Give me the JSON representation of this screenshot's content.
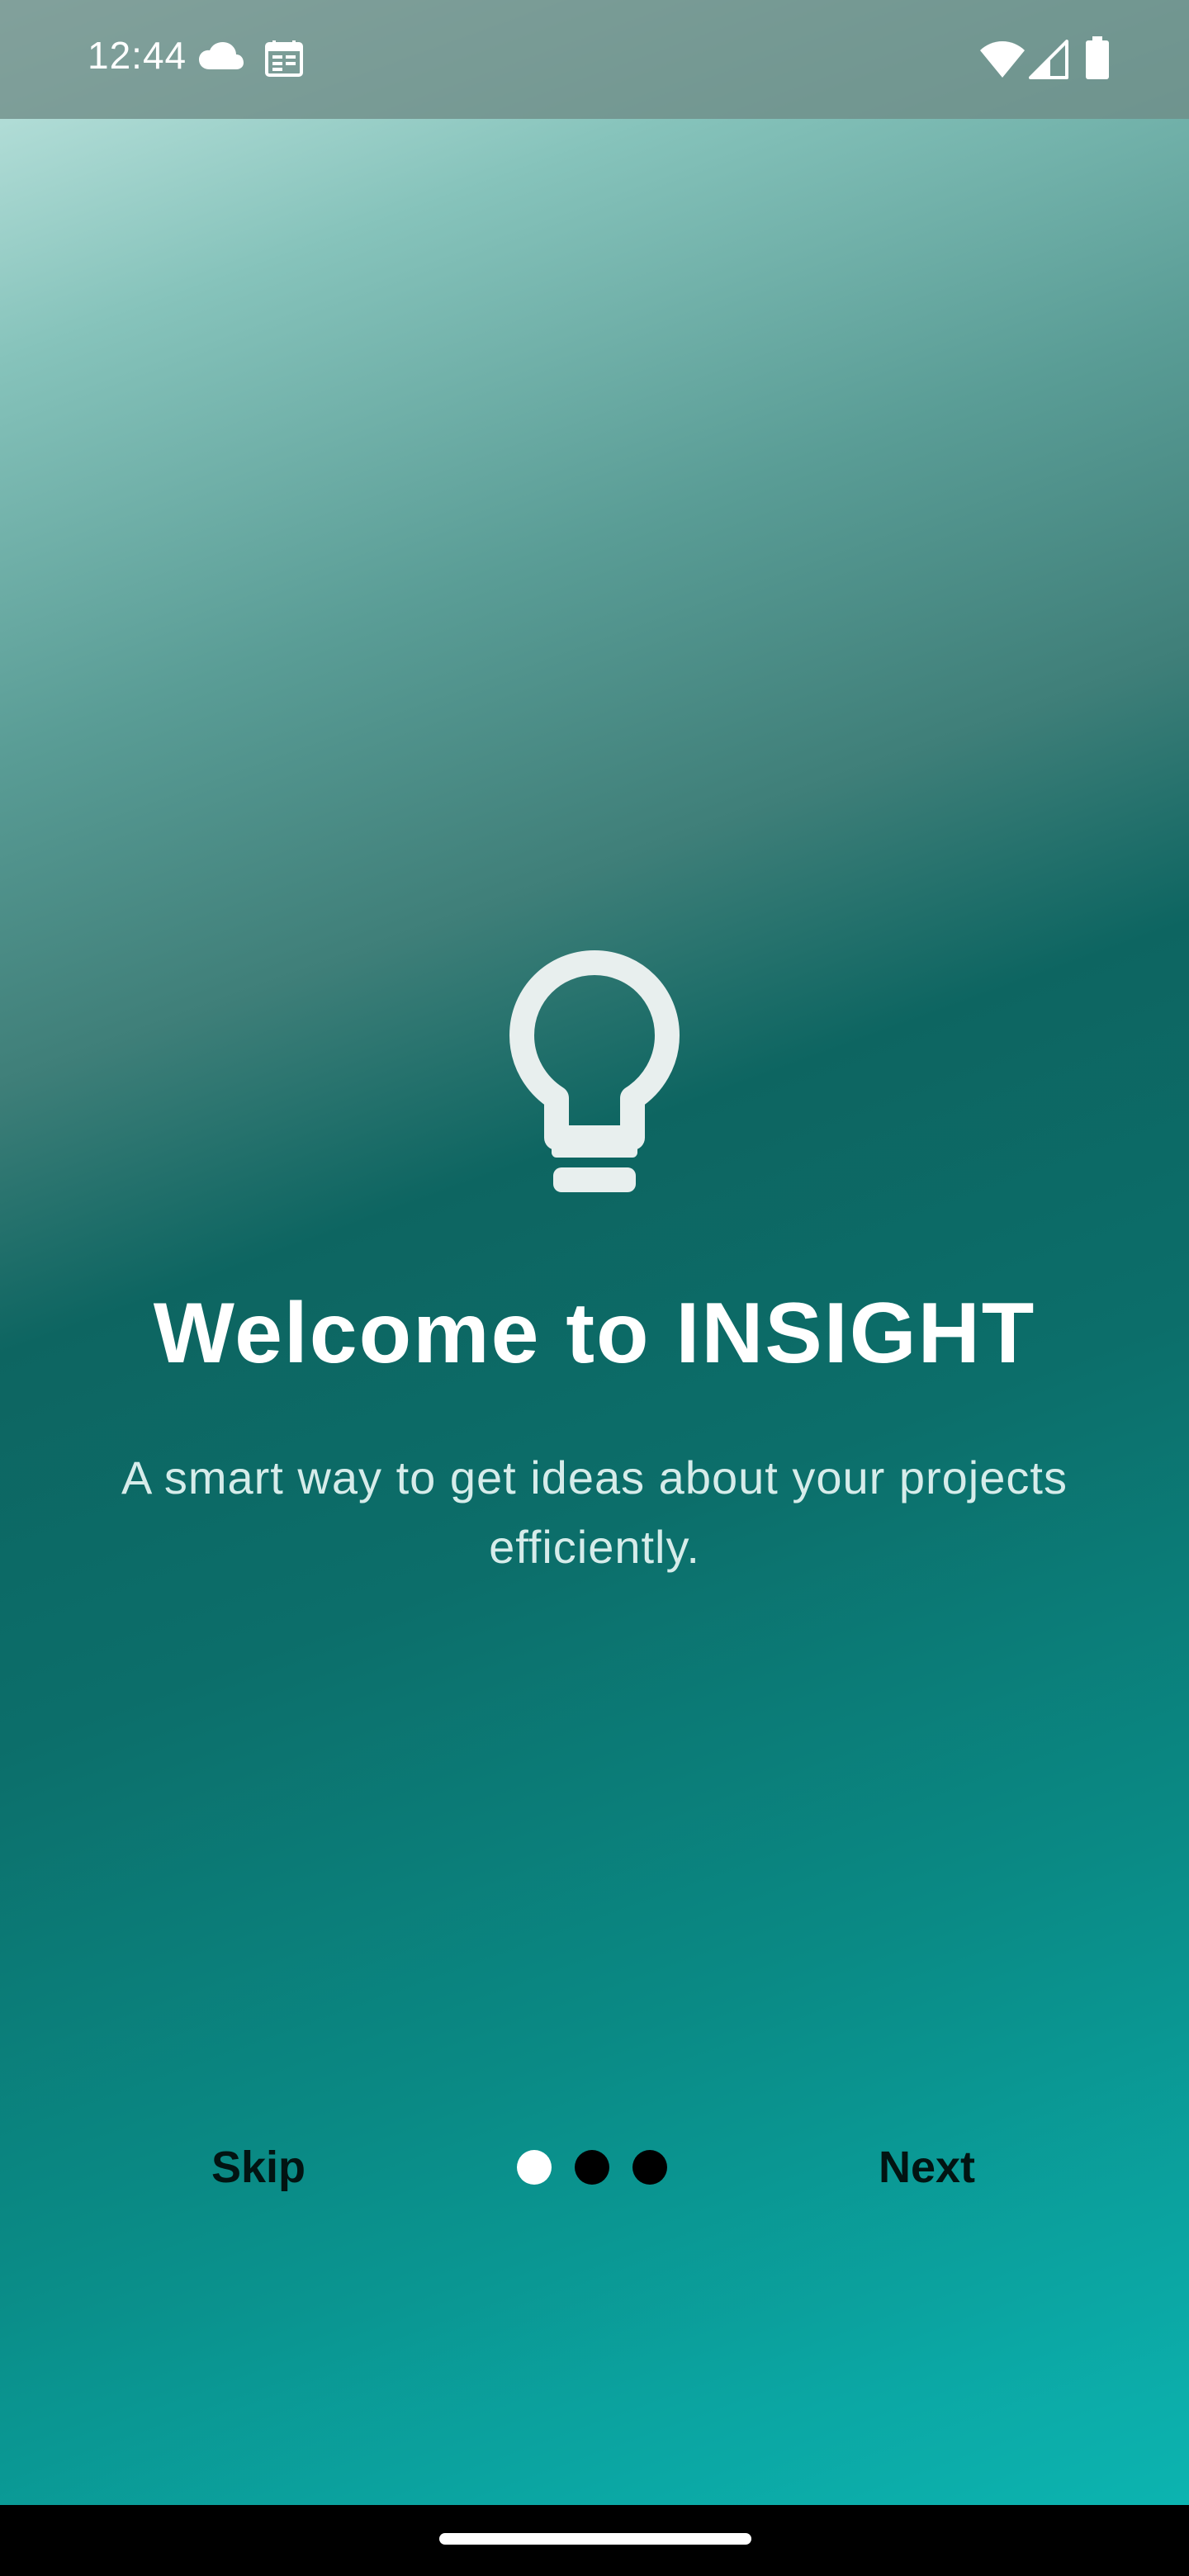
{
  "status_bar": {
    "time": "12:44",
    "icons": [
      "cloud-icon",
      "calendar-icon",
      "wifi-icon",
      "signal-icon",
      "battery-icon"
    ]
  },
  "onboarding": {
    "icon": "lightbulb-icon",
    "title": "Welcome to INSIGHT",
    "subtitle": "A smart way to get ideas about your projects efficiently.",
    "skip_label": "Skip",
    "next_label": "Next",
    "page_indicator": {
      "total_pages": 3,
      "current_page": 1
    }
  },
  "colors": {
    "gradient_top": "#c6e9e4",
    "gradient_mid": "#0d6561",
    "gradient_bottom": "#0db8b4",
    "active_dot": "#ffffff",
    "inactive_dot": "#000000",
    "button_text": "#021412"
  }
}
